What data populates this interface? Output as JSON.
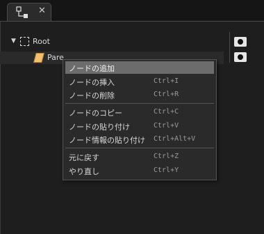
{
  "tab": {
    "close_glyph": "✕",
    "icon": "node-graph-icon"
  },
  "tree": {
    "root": {
      "label": "Root",
      "expand_glyph": "▼"
    },
    "child": {
      "label": "Pare"
    }
  },
  "context_menu": {
    "items": [
      {
        "label": "ノードの追加",
        "shortcut": ""
      },
      {
        "label": "ノードの挿入",
        "shortcut": "Ctrl+I"
      },
      {
        "label": "ノードの削除",
        "shortcut": "Ctrl+R"
      },
      {
        "label": "ノードのコピー",
        "shortcut": "Ctrl+C"
      },
      {
        "label": "ノードの貼り付け",
        "shortcut": "Ctrl+V"
      },
      {
        "label": "ノード情報の貼り付け",
        "shortcut": "Ctrl+Alt+V"
      },
      {
        "label": "元に戻す",
        "shortcut": "Ctrl+Z"
      },
      {
        "label": "やり直し",
        "shortcut": "Ctrl+Y"
      }
    ]
  },
  "colors": {
    "highlight": "#6c6c6c",
    "background": "#1e1e1e",
    "node_icon": "#f0c070"
  }
}
